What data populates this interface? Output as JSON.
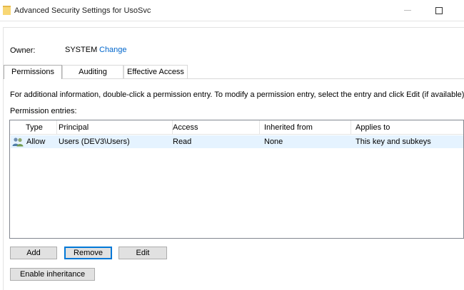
{
  "window": {
    "title": "Advanced Security Settings for UsoSvc"
  },
  "owner": {
    "label": "Owner:",
    "value": "SYSTEM",
    "change_link": "Change"
  },
  "tabs": [
    {
      "label": "Permissions",
      "active": true
    },
    {
      "label": "Auditing",
      "active": false
    },
    {
      "label": "Effective Access",
      "active": false
    }
  ],
  "info_text": "For additional information, double-click a permission entry. To modify a permission entry, select the entry and click Edit (if available).",
  "entries_label": "Permission entries:",
  "table": {
    "columns": [
      "Type",
      "Principal",
      "Access",
      "Inherited from",
      "Applies to"
    ],
    "rows": [
      {
        "icon": "users-icon",
        "type": "Allow",
        "principal": "Users (DEV3\\Users)",
        "access": "Read",
        "inherited_from": "None",
        "applies_to": "This key and subkeys"
      }
    ]
  },
  "buttons": {
    "add": "Add",
    "remove": "Remove",
    "edit": "Edit",
    "enable_inheritance": "Enable inheritance"
  },
  "colors": {
    "link": "#0066cc",
    "row_highlight": "#e5f3ff",
    "focus_border": "#0078d7",
    "folder_icon": "#f8d775"
  }
}
